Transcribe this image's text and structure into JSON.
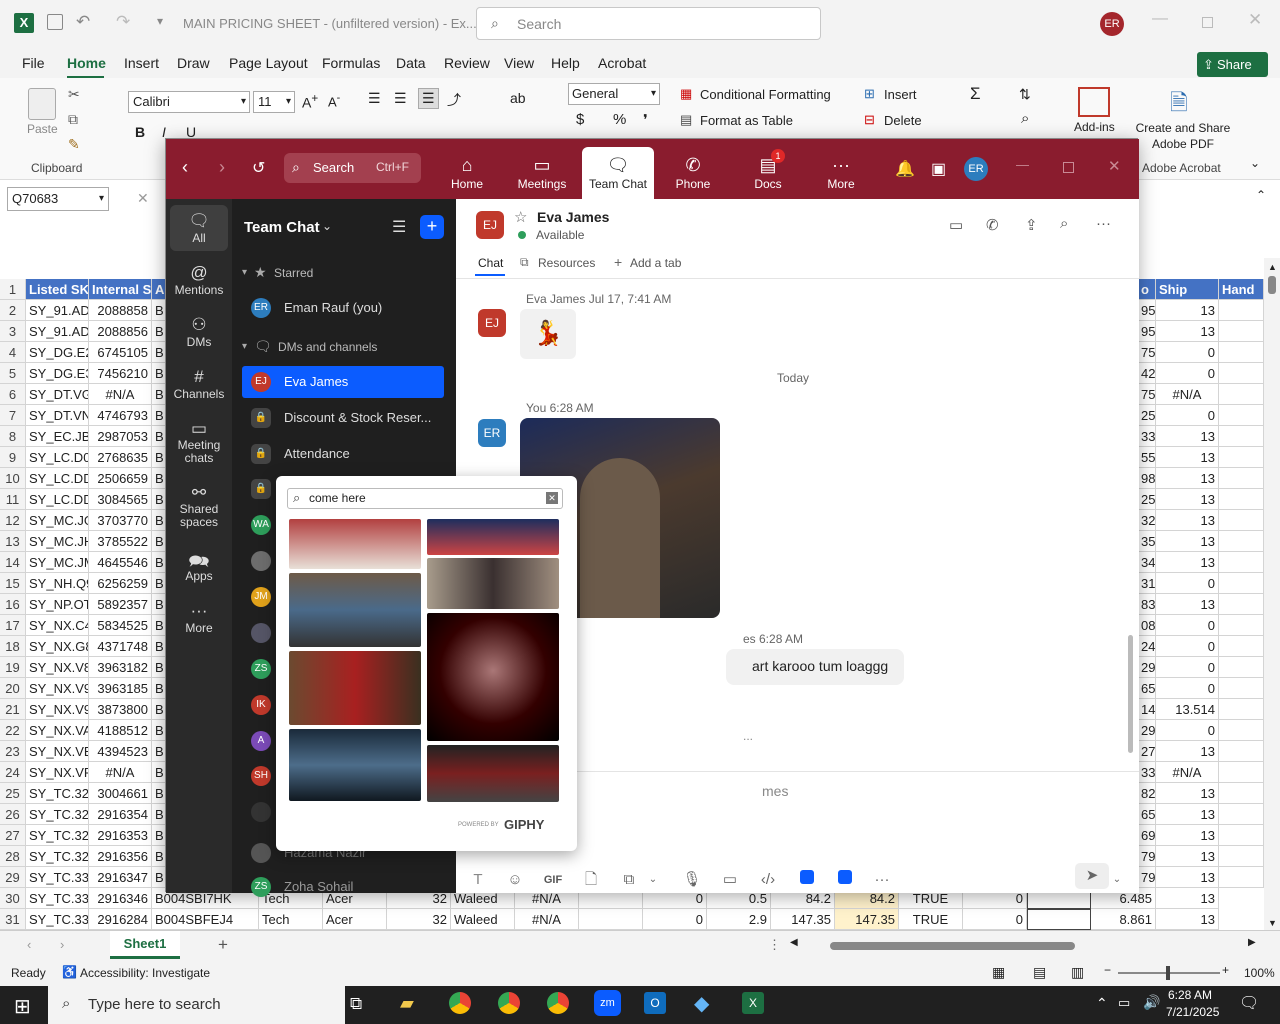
{
  "excel": {
    "title": "MAIN PRICING SHEET - (unfiltered version) - Ex...",
    "search_placeholder": "Search",
    "user_initials": "ER",
    "share_label": "Share",
    "tabs": [
      "File",
      "Home",
      "Insert",
      "Draw",
      "Page Layout",
      "Formulas",
      "Data",
      "Review",
      "View",
      "Help",
      "Acrobat"
    ],
    "font_name": "Calibri",
    "font_size": "11",
    "number_format": "General",
    "paste_label": "Paste",
    "clipboard_label": "Clipboard",
    "conditional_formatting": "Conditional Formatting",
    "format_as_table": "Format as Table",
    "insert_label": "Insert",
    "delete_label": "Delete",
    "addins_label": "Add-ins",
    "create_pdf_label": "Create and Share Adobe PDF",
    "adobe_acrobat_label": "Adobe Acrobat",
    "name_box": "Q70683",
    "col_headers_left": [
      "C",
      "D"
    ],
    "col_headers_right": [
      "T",
      "U"
    ],
    "header_row": {
      "c": "Listed SKU",
      "d": "Internal S",
      "e": "A",
      "s": "o",
      "t": "Ship",
      "u": "Hand"
    },
    "rows": [
      {
        "n": "2",
        "c": "SY_91.AD0",
        "d": "2088858",
        "e": "B",
        "s": "95",
        "t": "13"
      },
      {
        "n": "3",
        "c": "SY_91.AD0",
        "d": "2088856",
        "e": "B",
        "s": "95",
        "t": "13"
      },
      {
        "n": "4",
        "c": "SY_DG.E2Y",
        "d": "6745105",
        "e": "B",
        "s": "75",
        "t": "0"
      },
      {
        "n": "5",
        "c": "SY_DG.E3C",
        "d": "7456210",
        "e": "B",
        "s": "42",
        "t": "0"
      },
      {
        "n": "6",
        "c": "SY_DT.VG",
        "d": "#N/A",
        "e": "B",
        "s": "75",
        "t": "#N/A"
      },
      {
        "n": "7",
        "c": "SY_DT.VN",
        "d": "4746793",
        "e": "B",
        "s": "25",
        "t": "0"
      },
      {
        "n": "8",
        "c": "SY_EC.JBG",
        "d": "2987053",
        "e": "B",
        "s": "33",
        "t": "13"
      },
      {
        "n": "9",
        "c": "SY_LC.D01",
        "d": "2768635",
        "e": "B",
        "s": "55",
        "t": "13"
      },
      {
        "n": "10",
        "c": "SY_LC.DDI",
        "d": "2506659",
        "e": "B",
        "s": "98",
        "t": "13"
      },
      {
        "n": "11",
        "c": "SY_LC.DDI",
        "d": "3084565",
        "e": "B",
        "s": "25",
        "t": "13"
      },
      {
        "n": "12",
        "c": "SY_MC.JG",
        "d": "3703770",
        "e": "B",
        "s": "32",
        "t": "13"
      },
      {
        "n": "13",
        "c": "SY_MC.JH",
        "d": "3785522",
        "e": "B",
        "s": "35",
        "t": "13"
      },
      {
        "n": "14",
        "c": "SY_MC.JM",
        "d": "4645546",
        "e": "B",
        "s": "34",
        "t": "13"
      },
      {
        "n": "15",
        "c": "SY_NH.Q9",
        "d": "6256259",
        "e": "B",
        "s": "31",
        "t": "0"
      },
      {
        "n": "16",
        "c": "SY_NP.OT",
        "d": "5892357",
        "e": "B",
        "s": "83",
        "t": "13"
      },
      {
        "n": "17",
        "c": "SY_NX.C4",
        "d": "5834525",
        "e": "B",
        "s": "08",
        "t": "0"
      },
      {
        "n": "18",
        "c": "SY_NX.G8",
        "d": "4371748",
        "e": "B",
        "s": "24",
        "t": "0"
      },
      {
        "n": "19",
        "c": "SY_NX.V8",
        "d": "3963182",
        "e": "B",
        "s": "29",
        "t": "0"
      },
      {
        "n": "20",
        "c": "SY_NX.V9",
        "d": "3963185",
        "e": "B",
        "s": "65",
        "t": "0"
      },
      {
        "n": "21",
        "c": "SY_NX.V9",
        "d": "3873800",
        "e": "B",
        "s": "14",
        "t": "13.514"
      },
      {
        "n": "22",
        "c": "SY_NX.VA",
        "d": "4188512",
        "e": "B",
        "s": "29",
        "t": "0"
      },
      {
        "n": "23",
        "c": "SY_NX.VB",
        "d": "4394523",
        "e": "B",
        "s": "27",
        "t": "13"
      },
      {
        "n": "24",
        "c": "SY_NX.VP",
        "d": "#N/A",
        "e": "B",
        "s": "33",
        "t": "#N/A"
      },
      {
        "n": "25",
        "c": "SY_TC.322",
        "d": "3004661",
        "e": "B",
        "s": "82",
        "t": "13"
      },
      {
        "n": "26",
        "c": "SY_TC.327",
        "d": "2916354",
        "e": "B",
        "s": "65",
        "t": "13"
      },
      {
        "n": "27",
        "c": "SY_TC.327",
        "d": "2916353",
        "e": "B",
        "s": "69",
        "t": "13"
      },
      {
        "n": "28",
        "c": "SY_TC.327",
        "d": "2916356",
        "e": "B",
        "s": "79",
        "t": "13"
      },
      {
        "n": "29",
        "c": "SY_TC.331",
        "d": "2916347",
        "e": "B",
        "s": "79",
        "t": "13"
      }
    ],
    "full_rows": [
      {
        "n": "30",
        "c": "SY_TC.331",
        "d": "2916346",
        "e": "B004SBI7HK",
        "f": "Tech",
        "g": "Acer",
        "h": "32",
        "i": "Waleed",
        "j": "#N/A",
        "k": "",
        "l": "0",
        "m": "0.5",
        "o": "84.2",
        "p": "84.2",
        "q": "TRUE",
        "r": "0",
        "s2": "",
        "s": "6.485",
        "t": "13"
      },
      {
        "n": "31",
        "c": "SY_TC.336",
        "d": "2916284",
        "e": "B004SBFEJ4",
        "f": "Tech",
        "g": "Acer",
        "h": "32",
        "i": "Waleed",
        "j": "#N/A",
        "k": "",
        "l": "0",
        "m": "2.9",
        "o": "147.35",
        "p": "147.35",
        "q": "TRUE",
        "r": "0",
        "s2": "",
        "s": "8.861",
        "t": "13"
      }
    ],
    "sheet_name": "Sheet1",
    "status_ready": "Ready",
    "accessibility": "Accessibility: Investigate",
    "zoom_level": "100%"
  },
  "zoom": {
    "search_label": "Search",
    "search_shortcut": "Ctrl+F",
    "nav": [
      {
        "label": "Home",
        "icon": "home-icon"
      },
      {
        "label": "Meetings",
        "icon": "video-icon"
      },
      {
        "label": "Team Chat",
        "icon": "chat-icon"
      },
      {
        "label": "Phone",
        "icon": "phone-icon"
      },
      {
        "label": "Docs",
        "icon": "docs-icon",
        "badge": "1"
      },
      {
        "label": "More",
        "icon": "more-icon"
      }
    ],
    "user_initials": "ER",
    "rail": [
      {
        "label": "All",
        "icon": "chat-bubble-icon"
      },
      {
        "label": "Mentions",
        "icon": "at-icon"
      },
      {
        "label": "DMs",
        "icon": "people-icon"
      },
      {
        "label": "Channels",
        "icon": "hash-icon"
      },
      {
        "label": "Meeting chats",
        "icon": "calendar-icon"
      },
      {
        "label": "Shared spaces",
        "icon": "shared-icon"
      },
      {
        "label": "Apps",
        "icon": "apps-icon"
      },
      {
        "label": "More",
        "icon": "more-icon"
      }
    ],
    "list_title": "Team Chat",
    "starred_label": "Starred",
    "eman": "Eman Rauf (you)",
    "dms_label": "DMs and channels",
    "items": [
      "Eva James",
      "Discount & Stock Reser...",
      "Attendance"
    ],
    "bottom_items": [
      "Hazama Nazir",
      "Zoha Sohail"
    ],
    "side_avatars": [
      "WA",
      "JM",
      "ZS",
      "IK",
      "A",
      "SH"
    ],
    "contact_name": "Eva James",
    "contact_status": "Available",
    "contact_initials": "EJ",
    "chat_tabs": [
      "Chat",
      "Resources",
      "Add a tab"
    ],
    "msg1_meta": "Eva James Jul 17, 7:41 AM",
    "day_divider": "Today",
    "msg2_meta": "You 6:28 AM",
    "msg3_meta": "es 6:28 AM",
    "msg3_text": "art karooo tum loaggg",
    "typing_dots": "...",
    "composer_placeholder": "mes",
    "gif_label": "GIF"
  },
  "gif": {
    "search_value": "come here",
    "powered_by": "POWERED BY",
    "brand": "GIPHY"
  },
  "taskbar": {
    "search_placeholder": "Type here to search",
    "time": "6:28 AM",
    "date": "7/21/2025"
  }
}
